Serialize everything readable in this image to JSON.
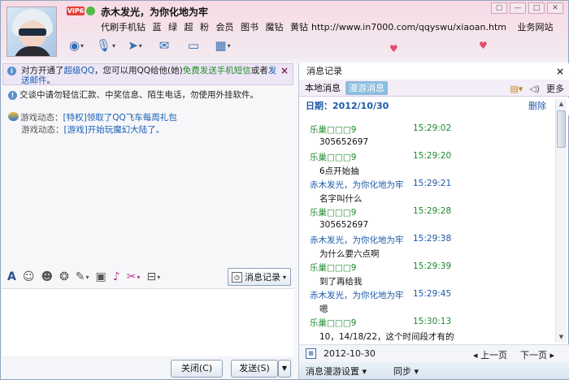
{
  "header": {
    "nickname": "赤木发光，为你化地为牢",
    "vip_badge": "VIP6",
    "links": [
      "代刷手机钻",
      "蓝",
      "绿",
      "超",
      "粉",
      "会员",
      "图书",
      "魔钻",
      "黄钻"
    ],
    "url": "http://www.in7000.com/qqyswu/xiaoan.htm",
    "url_suffix": "业务网站"
  },
  "window_buttons": {
    "skin": "▢",
    "minimize": "—",
    "maximize": "□",
    "close": "✕"
  },
  "toolbar_icons": [
    "video-call-icon",
    "voice-call-icon",
    "transfer-file-icon",
    "sms-icon",
    "remote-desktop-icon",
    "app-icon"
  ],
  "notice": {
    "part1": "对方开通了",
    "link1": "超级QQ",
    "part2": "，您可以用QQ给他(她)",
    "link2": "免费发送手机短信",
    "part3": "或者",
    "link3": "发送邮件",
    "part4": "。",
    "close": "×"
  },
  "warning": "交谈中请勿轻信汇款、中奖信息、陌生电话，勿使用外挂软件。",
  "game_updates": [
    {
      "label": "游戏动态：",
      "item": "[特权]领取了QQ飞车每周礼包"
    },
    {
      "label": "游戏动态：",
      "item": "[游戏]开始玩魔幻大陆了。"
    }
  ],
  "input_toolbar": {
    "message_record": "消息记录"
  },
  "buttons": {
    "close": "关闭(C)",
    "send": "发送(S)",
    "send_arrow": "▼"
  },
  "history": {
    "title": "消息记录",
    "close": "×",
    "tab_local": "本地消息",
    "tab_roam": "漫游消息",
    "more": "更多",
    "date_label": "日期：2012/10/30",
    "delete": "删除",
    "messages": [
      {
        "sender": "乐巢□□□9",
        "time": "15:29:02",
        "text": "305652697",
        "color": "g"
      },
      {
        "sender": "乐巢□□□9",
        "time": "15:29:20",
        "text": "6点开始抽",
        "color": "g"
      },
      {
        "sender": "赤木发光，为你化地为牢",
        "time": "15:29:21",
        "text": "名字叫什么",
        "color": "b"
      },
      {
        "sender": "乐巢□□□9",
        "time": "15:29:28",
        "text": "305652697",
        "color": "g"
      },
      {
        "sender": "赤木发光，为你化地为牢",
        "time": "15:29:38",
        "text": "为什么要六点啊",
        "color": "b"
      },
      {
        "sender": "乐巢□□□9",
        "time": "15:29:39",
        "text": "到了再给我",
        "color": "g"
      },
      {
        "sender": "赤木发光，为你化地为牢",
        "time": "15:29:45",
        "text": "嗯",
        "color": "b"
      },
      {
        "sender": "乐巢□□□9",
        "time": "15:30:13",
        "text": "10，14/18/22，这个时间段才有的",
        "color": "g"
      }
    ],
    "nav_date": "2012-10-30",
    "prev_page": "◂ 上一页",
    "next_page": "下一页 ▸",
    "roam_settings": "消息漫游设置 ▾",
    "sync": "同步 ▾"
  }
}
